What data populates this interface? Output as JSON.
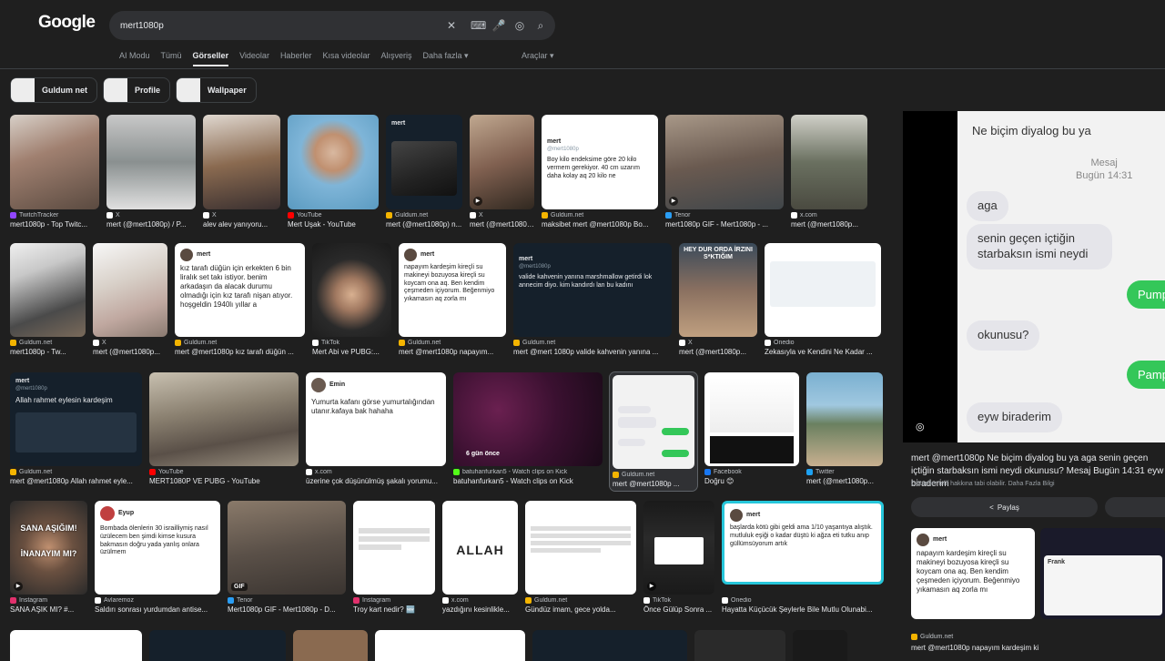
{
  "logo": "Google",
  "search": {
    "query": "mert1080p",
    "icons": [
      "close-icon",
      "keyboard-icon",
      "mic-icon",
      "lens-icon",
      "search-icon"
    ]
  },
  "tabs": [
    "AI Modu",
    "Tümü",
    "Görseller",
    "Videolar",
    "Haberler",
    "Kısa videolar",
    "Alışveriş",
    "Daha fazla ▾"
  ],
  "active_tab": "Görseller",
  "tools_label": "Araçlar ▾",
  "chips": [
    "Guldum net",
    "Profile",
    "Wallpaper"
  ],
  "results": {
    "row1": [
      {
        "source": "TwitchTracker",
        "title": "mert1080p - Top Twitc...",
        "fav": "#9146ff",
        "thumb": "#8a6a55"
      },
      {
        "source": "X",
        "title": "mert (@mert1080p) / P...",
        "fav": "#ffffff",
        "thumb": "#9aa0a0"
      },
      {
        "source": "X",
        "title": "alev alev yanıyoru...",
        "fav": "#ffffff",
        "thumb": "#6b5a4b"
      },
      {
        "source": "YouTube",
        "title": "Mert Uşak - YouTube",
        "fav": "#ff0000",
        "thumb": "#7fb5d8"
      },
      {
        "source": "Guldum.net",
        "title": "mert (@mert1080p) n...",
        "fav": "#f4b400",
        "thumb": "#15202b"
      },
      {
        "source": "X",
        "title": "mert (@mert1080p...",
        "fav": "#ffffff",
        "thumb": "#5a4a3a"
      },
      {
        "source": "Guldum.net",
        "title": "maksibet mert @mert1080p Bo...",
        "fav": "#f4b400",
        "thumb": "#ffffff"
      },
      {
        "source": "Tenor",
        "title": "mert1080p GIF - Mert1080p - ...",
        "fav": "#2a9df4",
        "thumb": "#6a5a50"
      },
      {
        "source": "x.com",
        "title": "mert (@mert1080p...",
        "fav": "#ffffff",
        "thumb": "#7a7a6a"
      }
    ],
    "row2": [
      {
        "source": "Guldum.net",
        "title": "mert1080p - Tw...",
        "fav": "#f4b400",
        "thumb": "#e8e8e8"
      },
      {
        "source": "X",
        "title": "mert (@mert1080p...",
        "fav": "#ffffff",
        "thumb": "#d0cfc8"
      },
      {
        "source": "Guldum.net",
        "title": "mert @mert1080p kız tarafı düğün ...",
        "fav": "#f4b400",
        "thumb": "#ffffff"
      },
      {
        "source": "TikTok",
        "title": "Mert Abi ve PUBG:...",
        "fav": "#ffffff",
        "thumb": "#2a2a2a"
      },
      {
        "source": "Guldum.net",
        "title": "mert @mert1080p napayım...",
        "fav": "#f4b400",
        "thumb": "#ffffff"
      },
      {
        "source": "Guldum.net",
        "title": "mert @mert 1080p valide kahvenin yanına ...",
        "fav": "#f4b400",
        "thumb": "#15202b"
      },
      {
        "source": "X",
        "title": "mert (@mert1080p...",
        "fav": "#ffffff",
        "thumb": "#3a4a5a"
      },
      {
        "source": "Onedio",
        "title": "Zekasıyla ve Kendini Ne Kadar ...",
        "fav": "#ffffff",
        "thumb": "#ffffff"
      }
    ],
    "row3": [
      {
        "source": "Guldum.net",
        "title": "mert @mert1080p Allah rahmet eyle...",
        "fav": "#f4b400",
        "thumb": "#15202b"
      },
      {
        "source": "YouTube",
        "title": "MERT1080P VE PUBG - YouTube",
        "fav": "#ff0000",
        "thumb": "#8a8a7a"
      },
      {
        "source": "x.com",
        "title": "üzerine çok düşünülmüş şakalı yorumu...",
        "fav": "#ffffff",
        "thumb": "#ffffff"
      },
      {
        "source": "batuhanfurkan5 - Watch clips on Kick",
        "title": "batuhanfurkan5 - Watch clips on Kick",
        "fav": "#53fc18",
        "thumb": "#3a1030"
      },
      {
        "source": "Guldum.net",
        "title": "mert @mert1080p ...",
        "fav": "#f4b400",
        "thumb": "#f2f2f2"
      },
      {
        "source": "Facebook",
        "title": "Doğru 😊",
        "fav": "#1877f2",
        "thumb": "#ffffff"
      },
      {
        "source": "Twitter",
        "title": "mert (@mert1080p...",
        "fav": "#1da1f2",
        "thumb": "#5a9ac0"
      }
    ],
    "row4": [
      {
        "source": "Instagram",
        "title": "SANA AŞIK MI? #...",
        "fav": "#e1306c",
        "thumb": "#3a3a3a"
      },
      {
        "source": "Avlaremoz",
        "title": "Saldırı sonrası yurdumdan antise...",
        "fav": "#ffffff",
        "thumb": "#ffffff"
      },
      {
        "source": "Tenor",
        "title": "Mert1080p GIF - Mert1080p - D...",
        "fav": "#2a9df4",
        "thumb": "#5a5048"
      },
      {
        "source": "Instagram",
        "title": "Troy kart nedir? 🆕",
        "fav": "#e1306c",
        "thumb": "#ffffff"
      },
      {
        "source": "x.com",
        "title": "yazdığını kesinlikle...",
        "fav": "#ffffff",
        "thumb": "#ffffff"
      },
      {
        "source": "Guldum.net",
        "title": "Gündüz imam, gece yolda...",
        "fav": "#f4b400",
        "thumb": "#ffffff"
      },
      {
        "source": "TikTok",
        "title": "Önce Gülüp Sonra ...",
        "fav": "#ffffff",
        "thumb": "#1a1a1a"
      },
      {
        "source": "Onedio",
        "title": "Hayatta Küçücük Şeylerle Bile Mutlu Olunabi...",
        "fav": "#ffffff",
        "thumb": "#ffffff"
      }
    ]
  },
  "tweets": {
    "t_row2_3": "kız tarafı düğün için erkekten 6 bin liralık set takı istiyor. benim arkadaşın da alacak durumu olmadığı için kız tarafı nişan atıyor. hoşgeldin 1940lı yıllar a",
    "t_row2_5": "napayım kardeşim kireçli su makineyi bozuyosa kireçli su koycam ona aq. Ben kendim çeşmeden içiyorum. Beğenmiyo yıkamasın aq zorla mı",
    "t_row2_6": "valide kahvenin yanına marshmallow getirdi lok annecim diyo. kim kandırdı lan bu kadını",
    "t_row3_1": "Allah rahmet eylesin kardeşim",
    "t_row3_3": "Yumurta kafanı görse yumurtalığından utanır.kafaya bak hahaha",
    "t_row1_7": "Boy kilo endeksime göre 20 kilo vermem gerekiyor. 40 cm uzarım daha kolay aq 20 kilo ne",
    "t_row4_2": "Bombada ölenlerin 30 israilliymiş nasıl üzülecem ben şimdi kimse kusura bakmasın doğru yada yanlış onlara üzülmem",
    "t_row4_8": "başlarda kötü gibi geldi ama 1/10 yaşantıya alıştık. mutluluk eşiği o kadar düştü ki ağza eti tutku anıp güllümsüyorum artık",
    "name": "mert",
    "handle": "@mert1080p",
    "label_sana": "SANA AŞIĞIM!",
    "label_inanayim": "İNANAYIM MI?",
    "label_allah": "ALLAH",
    "label_gif": "GIF",
    "label_hey": "HEY DUR ORDA İRZINI S*KTIĞIM",
    "label_6gun": "6 gün önce"
  },
  "panel": {
    "chat_header": "Ne biçim diyalog bu ya",
    "chat_date_1": "Mesaj",
    "chat_date_2": "Bugün 14:31",
    "bubbles_in": [
      "aga",
      "senin geçen içtiğin starbaksın ismi neydi",
      "okunusu?",
      "eyw biraderim"
    ],
    "bubbles_out": [
      "Pump",
      "Pamp"
    ],
    "caption": "mert @mert1080p Ne biçim diyalog bu ya aga senin geçen içtiğin starbaksın ismi neydi okunusu? Mesaj Bugün 14:31 eyw biraderim",
    "meta": "Görseller telif hakkına tabi olabilir. Daha Fazla Bilgi",
    "share_label": "Paylaş",
    "related_source": "Guldum.net",
    "related_title": "mert @mert1080p napayım kardeşim kireç...",
    "related_name": "Frank"
  }
}
